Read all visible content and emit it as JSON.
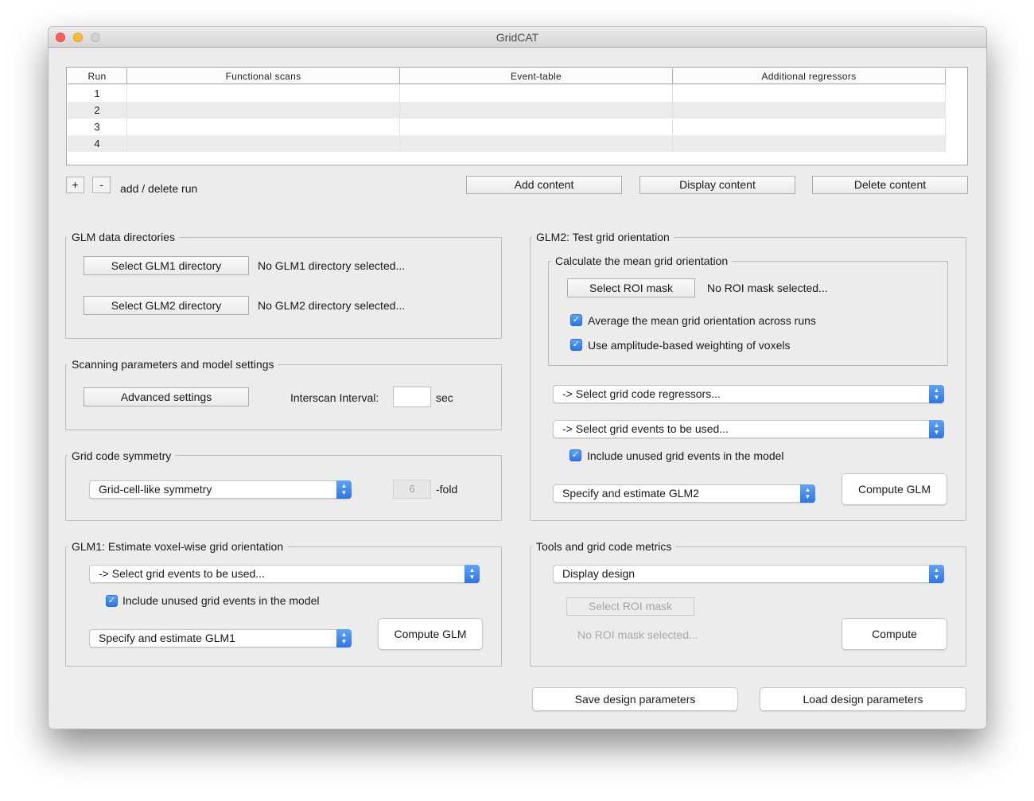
{
  "window": {
    "title": "GridCAT"
  },
  "table": {
    "headers": [
      "Run",
      "Functional scans",
      "Event-table",
      "Additional regressors"
    ],
    "rows": [
      {
        "run": "1",
        "functional": "",
        "event": "",
        "regressors": ""
      },
      {
        "run": "2",
        "functional": "",
        "event": "",
        "regressors": ""
      },
      {
        "run": "3",
        "functional": "",
        "event": "",
        "regressors": ""
      },
      {
        "run": "4",
        "functional": "",
        "event": "",
        "regressors": ""
      }
    ]
  },
  "runs": {
    "add_label": "+",
    "delete_label": "-",
    "caption": "add / delete run"
  },
  "content_buttons": {
    "add": "Add content",
    "display": "Display content",
    "delete": "Delete content"
  },
  "glm_dirs": {
    "title": "GLM data directories",
    "glm1_button": "Select GLM1 directory",
    "glm1_status": "No GLM1 directory selected...",
    "glm2_button": "Select GLM2 directory",
    "glm2_status": "No GLM2 directory selected..."
  },
  "scanning": {
    "title": "Scanning parameters and model settings",
    "advanced_button": "Advanced settings",
    "interval_label": "Interscan Interval:",
    "interval_value": "",
    "unit": "sec"
  },
  "symmetry": {
    "title": "Grid code symmetry",
    "selected": "Grid-cell-like symmetry",
    "fold_value": "6",
    "fold_label": "-fold"
  },
  "glm1": {
    "title": "GLM1: Estimate voxel-wise grid orientation",
    "events_select": "-> Select grid events to be used...",
    "include_unused_label": "Include unused grid events in the model",
    "include_unused_checked": true,
    "mode_select": "Specify and estimate GLM1",
    "compute_button": "Compute GLM"
  },
  "glm2": {
    "title": "GLM2: Test grid orientation",
    "mean": {
      "title": "Calculate the mean grid orientation",
      "roi_button": "Select ROI mask",
      "roi_status": "No ROI mask selected...",
      "average_label": "Average the mean grid orientation across runs",
      "average_checked": true,
      "weighting_label": "Use amplitude-based weighting of voxels",
      "weighting_checked": true
    },
    "regressors_select": "-> Select grid code regressors...",
    "events_select": "-> Select grid events to be used...",
    "include_unused_label": "Include unused grid events in the model",
    "include_unused_checked": true,
    "mode_select": "Specify and estimate GLM2",
    "compute_button": "Compute GLM"
  },
  "tools": {
    "title": "Tools and grid code metrics",
    "select": "Display design",
    "roi_button": "Select ROI mask",
    "roi_status": "No ROI mask selected...",
    "compute_button": "Compute"
  },
  "footer": {
    "save": "Save design parameters",
    "load": "Load design parameters"
  },
  "colors": {
    "accent": "#2f76e6",
    "window_bg": "#ececec",
    "close": "#fc5f57",
    "minimize": "#fdbc2e"
  }
}
